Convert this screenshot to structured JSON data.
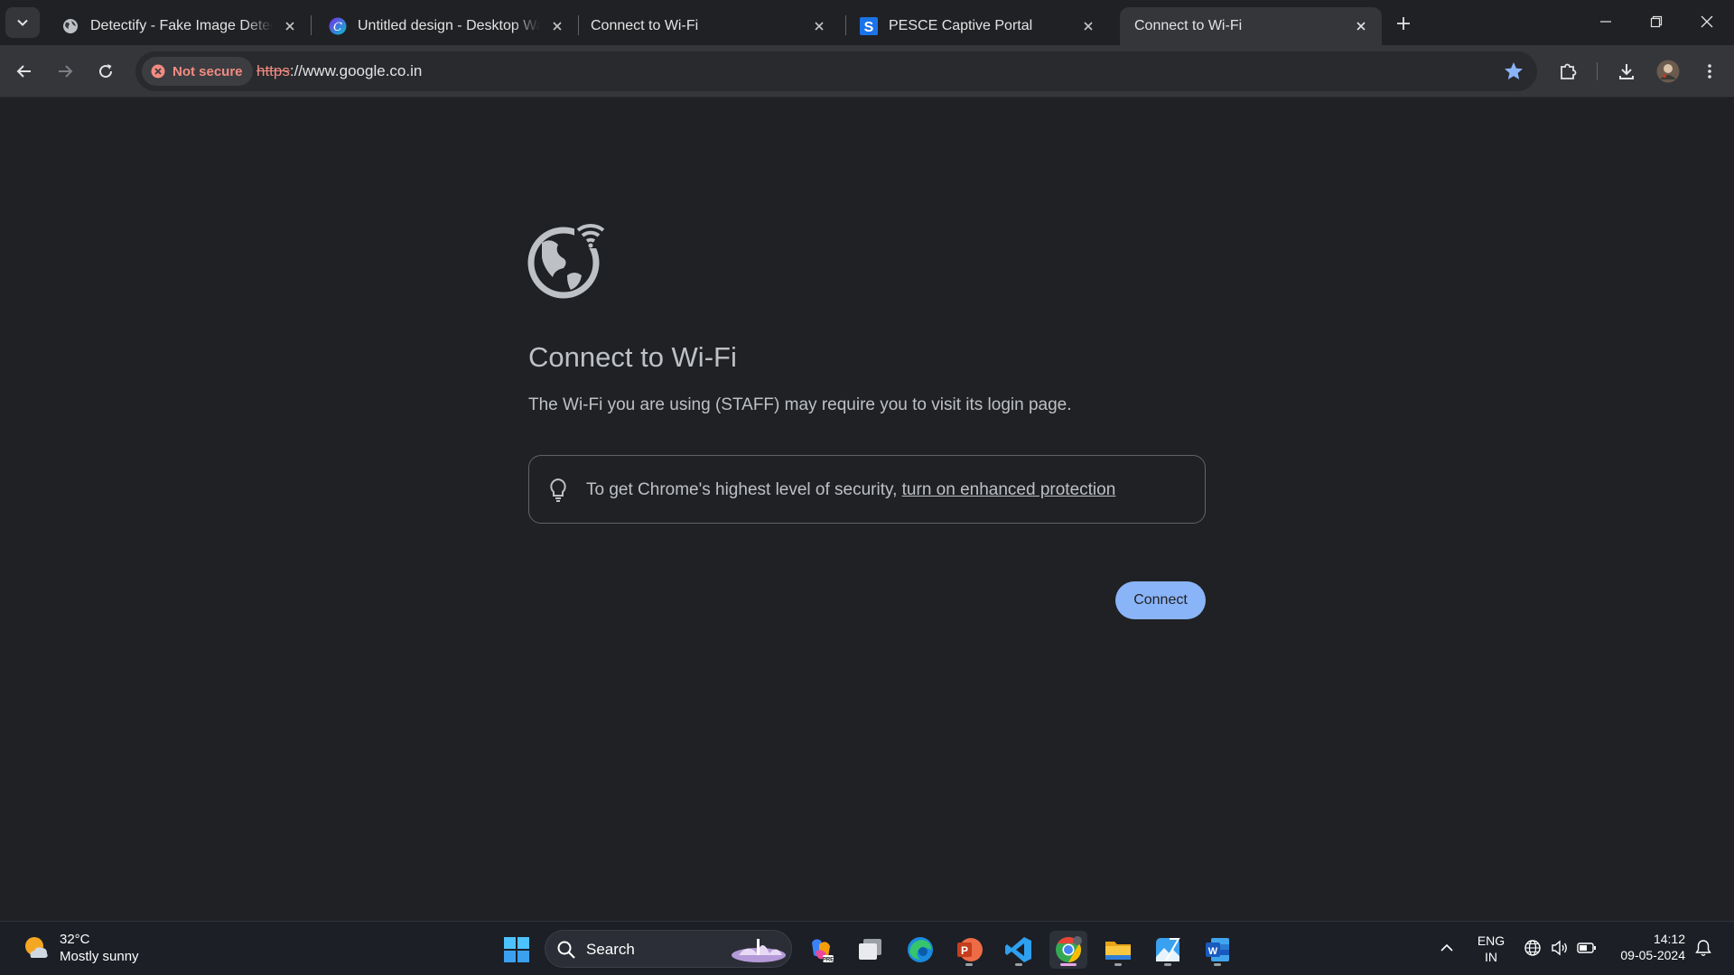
{
  "browser": {
    "tabs": [
      {
        "title": "Detectify - Fake Image Detectio",
        "favicon": "globe-icon",
        "active": false
      },
      {
        "title": "Untitled design - Desktop Wallp",
        "favicon": "canva-icon",
        "active": false
      },
      {
        "title": "Connect to Wi-Fi",
        "favicon": "",
        "active": false
      },
      {
        "title": "PESCE Captive Portal",
        "favicon": "s-logo-icon",
        "active": false
      },
      {
        "title": "Connect to Wi-Fi",
        "favicon": "",
        "active": true
      }
    ],
    "security_chip": "Not secure",
    "url_scheme": "https",
    "url_rest": "://www.google.co.in"
  },
  "page": {
    "heading": "Connect to Wi-Fi",
    "description": "The Wi-Fi you are using (STAFF) may require you to visit its login page.",
    "tip_prefix": "To get Chrome's highest level of security, ",
    "tip_link": "turn on enhanced protection",
    "connect_button": "Connect"
  },
  "taskbar": {
    "weather_temp": "32°C",
    "weather_desc": "Mostly sunny",
    "search_label": "Search",
    "lang_line1": "ENG",
    "lang_line2": "IN",
    "time": "14:12",
    "date": "09-05-2024"
  },
  "colors": {
    "page_bg": "#202124",
    "toolbar_bg": "#35363a",
    "accent_button": "#8ab4f8",
    "not_secure_red": "#f28b82",
    "bookmark_star": "#8ab4f8"
  }
}
